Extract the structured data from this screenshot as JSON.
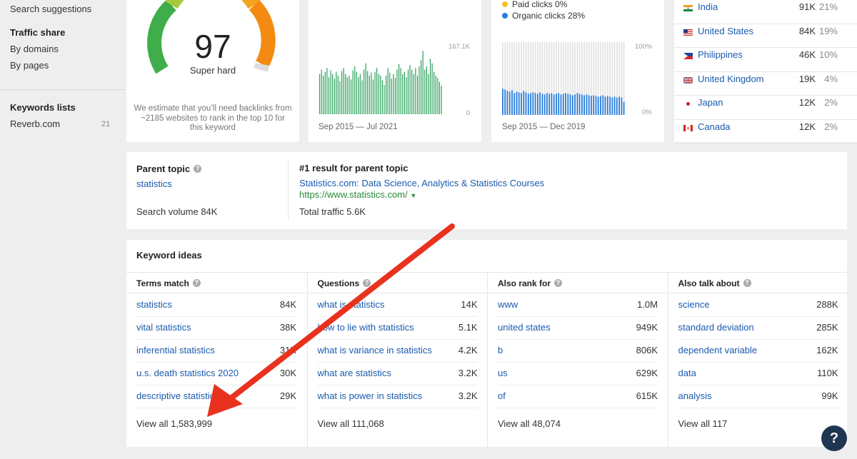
{
  "sidebar": {
    "search_suggestions": "Search suggestions",
    "traffic_share_heading": "Traffic share",
    "by_domains": "By domains",
    "by_pages": "By pages",
    "keywords_lists_heading": "Keywords lists",
    "list_name": "Reverb.com",
    "list_count": "21"
  },
  "difficulty": {
    "score": "97",
    "label": "Super hard",
    "note": "We estimate that you’ll need backlinks from ~2185 websites to rank in the top 10 for this keyword"
  },
  "volume_chart": {
    "y_max_label": "167.1K",
    "y_min_label": "0",
    "range_label": "Sep 2015 — Jul 2021",
    "color": "#2aa15a",
    "values": [
      0.52,
      0.58,
      0.5,
      0.55,
      0.6,
      0.48,
      0.57,
      0.52,
      0.46,
      0.55,
      0.5,
      0.43,
      0.56,
      0.6,
      0.52,
      0.48,
      0.5,
      0.45,
      0.57,
      0.62,
      0.55,
      0.48,
      0.52,
      0.44,
      0.58,
      0.66,
      0.56,
      0.5,
      0.54,
      0.45,
      0.55,
      0.6,
      0.52,
      0.5,
      0.44,
      0.38,
      0.5,
      0.6,
      0.54,
      0.46,
      0.52,
      0.47,
      0.58,
      0.65,
      0.6,
      0.52,
      0.55,
      0.48,
      0.58,
      0.64,
      0.58,
      0.52,
      0.6,
      0.5,
      0.62,
      0.7,
      0.82,
      0.58,
      0.62,
      0.52,
      0.72,
      0.66,
      0.55,
      0.5,
      0.47,
      0.42,
      0.37
    ]
  },
  "clicks_chart": {
    "legend": [
      {
        "label": "Paid clicks 0%",
        "color": "#f3c12a"
      },
      {
        "label": "Organic clicks 28%",
        "color": "#2a7ddb"
      }
    ],
    "y_max_label": "100%",
    "y_min_label": "0%",
    "range_label": "Sep 2015 — Dec 2019",
    "organic_values": [
      0.36,
      0.35,
      0.33,
      0.32,
      0.34,
      0.3,
      0.32,
      0.31,
      0.3,
      0.33,
      0.31,
      0.29,
      0.3,
      0.31,
      0.3,
      0.29,
      0.31,
      0.29,
      0.28,
      0.3,
      0.29,
      0.3,
      0.28,
      0.29,
      0.3,
      0.28,
      0.29,
      0.3,
      0.29,
      0.28,
      0.27,
      0.28,
      0.3,
      0.29,
      0.28,
      0.27,
      0.28,
      0.27,
      0.26,
      0.27,
      0.26,
      0.25,
      0.26,
      0.27,
      0.25,
      0.26,
      0.25,
      0.24,
      0.25,
      0.24,
      0.25,
      0.24,
      0.18
    ]
  },
  "countries": [
    {
      "name": "India",
      "volume": "91K",
      "share": "21%",
      "flag": "in"
    },
    {
      "name": "United States",
      "volume": "84K",
      "share": "19%",
      "flag": "us"
    },
    {
      "name": "Philippines",
      "volume": "46K",
      "share": "10%",
      "flag": "ph"
    },
    {
      "name": "United Kingdom",
      "volume": "19K",
      "share": "4%",
      "flag": "gb"
    },
    {
      "name": "Japan",
      "volume": "12K",
      "share": "2%",
      "flag": "jp"
    },
    {
      "name": "Canada",
      "volume": "12K",
      "share": "2%",
      "flag": "ca"
    }
  ],
  "parent_topic": {
    "heading": "Parent topic",
    "topic": "statistics",
    "search_volume": "Search volume 84K",
    "result_heading": "#1 result for parent topic",
    "result_title": "Statistics.com: Data Science, Analytics & Statistics Courses",
    "result_url": "https://www.statistics.com/",
    "total_traffic": "Total traffic 5.6K"
  },
  "keyword_ideas": {
    "title": "Keyword ideas",
    "columns": [
      {
        "heading": "Terms match",
        "rows": [
          {
            "keyword": "statistics",
            "volume": "84K"
          },
          {
            "keyword": "vital statistics",
            "volume": "38K"
          },
          {
            "keyword": "inferential statistics",
            "volume": "31K"
          },
          {
            "keyword": "u.s. death statistics 2020",
            "volume": "30K"
          },
          {
            "keyword": "descriptive statistics",
            "volume": "29K"
          }
        ],
        "view_all": "View all 1,583,999"
      },
      {
        "heading": "Questions",
        "rows": [
          {
            "keyword": "what is statistics",
            "volume": "14K"
          },
          {
            "keyword": "how to lie with statistics",
            "volume": "5.1K"
          },
          {
            "keyword": "what is variance in statistics",
            "volume": "4.2K"
          },
          {
            "keyword": "what are statistics",
            "volume": "3.2K"
          },
          {
            "keyword": "what is power in statistics",
            "volume": "3.2K"
          }
        ],
        "view_all": "View all 111,068"
      },
      {
        "heading": "Also rank for",
        "rows": [
          {
            "keyword": "www",
            "volume": "1.0M"
          },
          {
            "keyword": "united states",
            "volume": "949K"
          },
          {
            "keyword": "b",
            "volume": "806K"
          },
          {
            "keyword": "us",
            "volume": "629K"
          },
          {
            "keyword": "of",
            "volume": "615K"
          }
        ],
        "view_all": "View all 48,074"
      },
      {
        "heading": "Also talk about",
        "rows": [
          {
            "keyword": "science",
            "volume": "288K"
          },
          {
            "keyword": "standard deviation",
            "volume": "285K"
          },
          {
            "keyword": "dependent variable",
            "volume": "162K"
          },
          {
            "keyword": "data",
            "volume": "110K"
          },
          {
            "keyword": "analysis",
            "volume": "99K"
          }
        ],
        "view_all": "View all 117"
      }
    ]
  },
  "help_button": "?",
  "annotation_arrow_color": "#e8321e"
}
